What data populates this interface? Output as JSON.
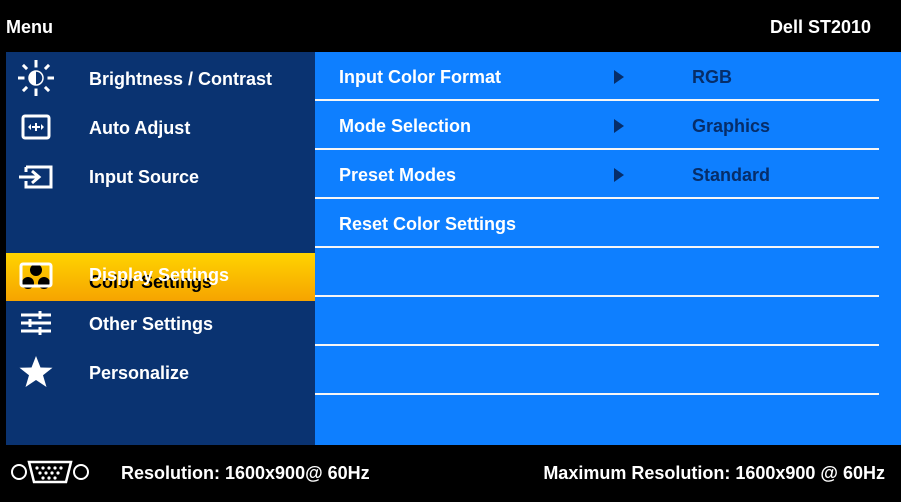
{
  "header": {
    "menu_label": "Menu",
    "model": "Dell ST2010"
  },
  "sidebar": {
    "items": [
      {
        "label": "Brightness / Contrast",
        "icon": "brightness-icon"
      },
      {
        "label": "Auto Adjust",
        "icon": "auto-adjust-icon"
      },
      {
        "label": "Input Source",
        "icon": "input-source-icon"
      },
      {
        "label": "Color Settings",
        "icon": "color-settings-icon",
        "selected": true
      },
      {
        "label": "Display Settings",
        "icon": "display-settings-icon"
      },
      {
        "label": "Other Settings",
        "icon": "other-settings-icon"
      },
      {
        "label": "Personalize",
        "icon": "star-icon"
      }
    ]
  },
  "content": {
    "rows": [
      {
        "label": "Input Color Format",
        "value": "RGB"
      },
      {
        "label": "Mode Selection",
        "value": "Graphics"
      },
      {
        "label": "Preset Modes",
        "value": "Standard"
      },
      {
        "label": "Reset Color Settings",
        "value": ""
      }
    ]
  },
  "footer": {
    "resolution": "Resolution: 1600x900@ 60Hz",
    "max_resolution": "Maximum Resolution: 1600x900 @ 60Hz",
    "icon": "vga-connector-icon"
  },
  "colors": {
    "sidebar_bg": "#0a3371",
    "content_bg": "#0e7fff",
    "selected": "#f6a400",
    "value_text": "#062d69"
  }
}
